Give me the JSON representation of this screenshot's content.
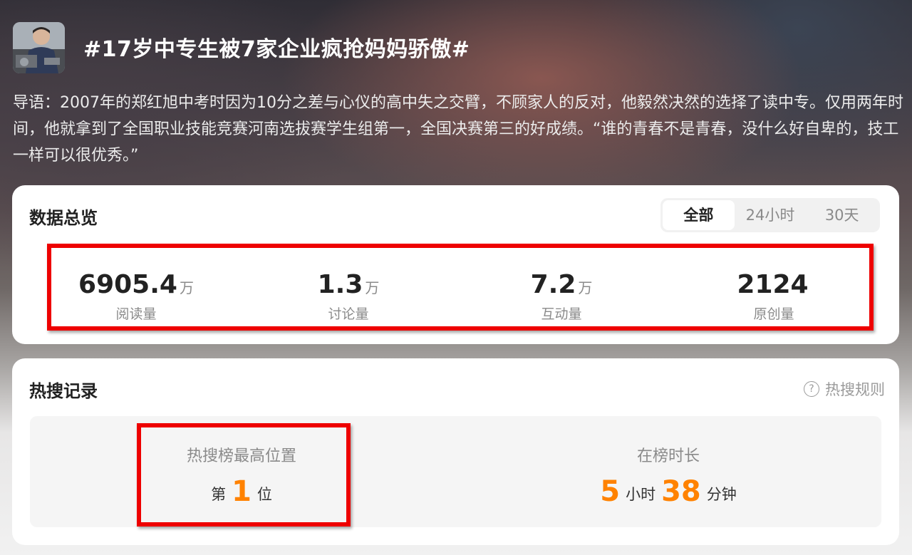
{
  "header": {
    "title": "#17岁中专生被7家企业疯抢妈妈骄傲#",
    "intro": "导语：2007年的郑红旭中考时因为10分之差与心仪的高中失之交臂，不顾家人的反对，他毅然决然的选择了读中专。仅用两年时间，他就拿到了全国职业技能竞赛河南选拔赛学生组第一，全国决赛第三的好成绩。“谁的青春不是青春，没什么好自卑的，技工一样可以很优秀。”"
  },
  "overview": {
    "title": "数据总览",
    "filters": [
      "全部",
      "24小时",
      "30天"
    ],
    "active_filter": "全部",
    "stats": [
      {
        "value": "6905.4",
        "unit": "万",
        "label": "阅读量"
      },
      {
        "value": "1.3",
        "unit": "万",
        "label": "讨论量"
      },
      {
        "value": "7.2",
        "unit": "万",
        "label": "互动量"
      },
      {
        "value": "2124",
        "unit": "",
        "label": "原创量"
      }
    ]
  },
  "hot": {
    "title": "热搜记录",
    "rules_label": "热搜规则",
    "help_glyph": "?",
    "highest": {
      "label": "热搜榜最高位置",
      "prefix": "第",
      "value": "1",
      "suffix": "位"
    },
    "duration": {
      "label": "在榜时长",
      "hours": "5",
      "hours_unit": "小时",
      "minutes": "38",
      "minutes_unit": "分钟"
    }
  },
  "colors": {
    "accent": "#ff8200",
    "highlight_border": "#ee0000"
  }
}
